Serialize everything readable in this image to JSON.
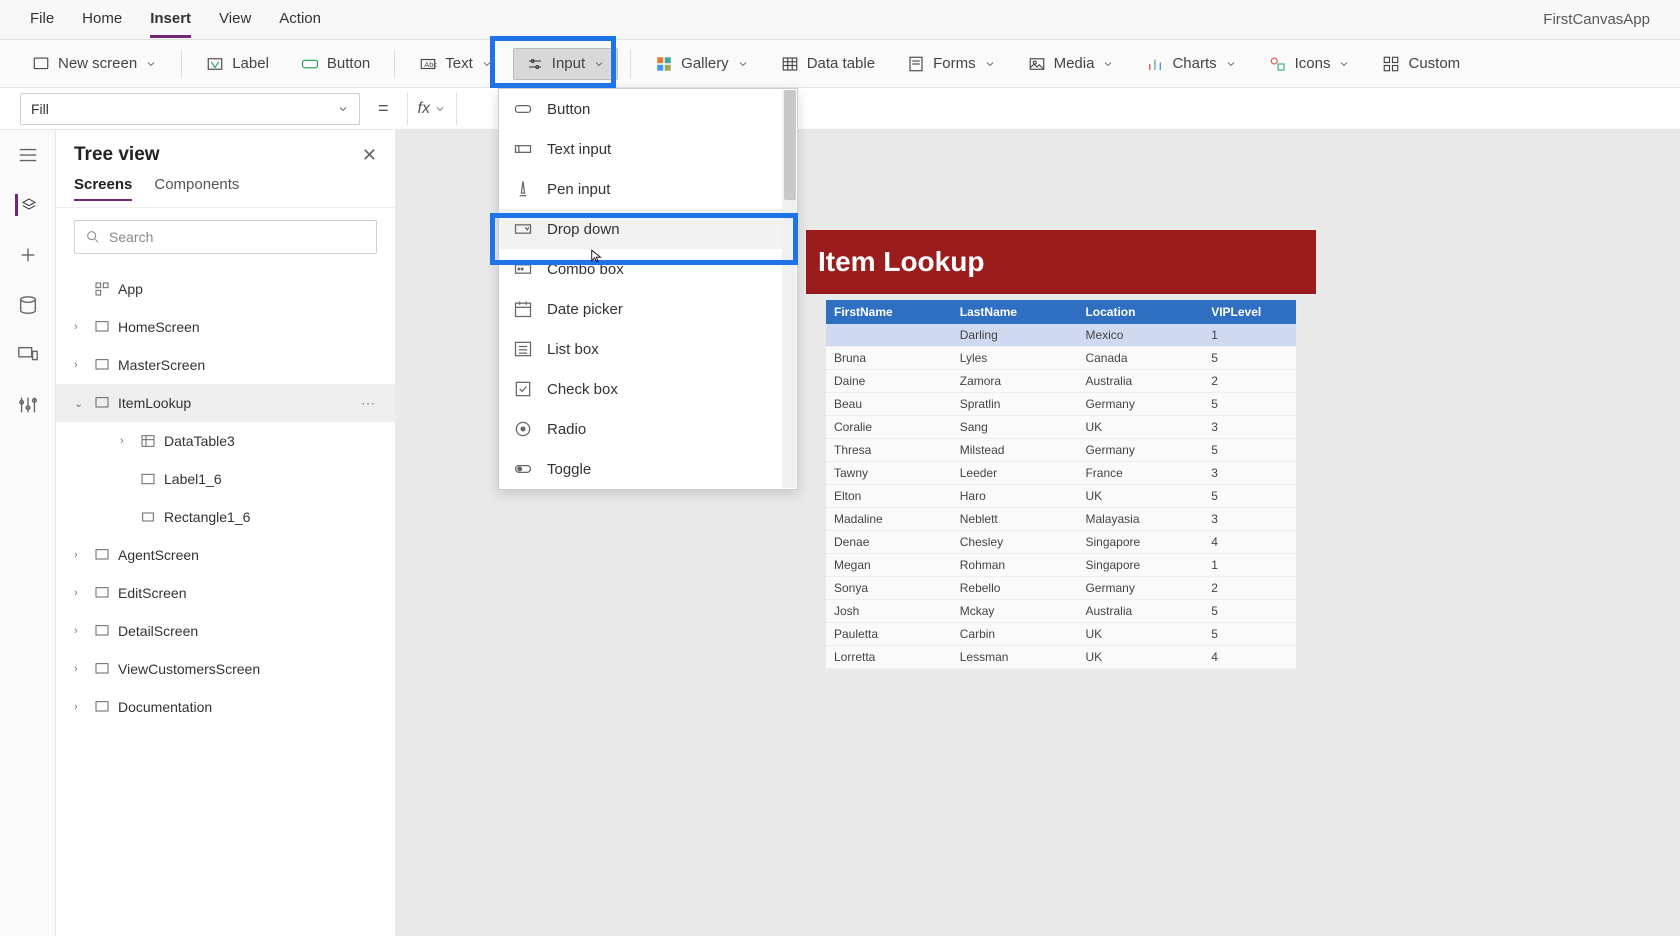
{
  "app_title": "FirstCanvasApp",
  "menubar": [
    "File",
    "Home",
    "Insert",
    "View",
    "Action"
  ],
  "menubar_active": "Insert",
  "ribbon": {
    "new_screen": "New screen",
    "label": "Label",
    "button": "Button",
    "text": "Text",
    "input": "Input",
    "gallery": "Gallery",
    "data_table": "Data table",
    "forms": "Forms",
    "media": "Media",
    "charts": "Charts",
    "icons": "Icons",
    "custom": "Custom"
  },
  "formula": {
    "property": "Fill",
    "fx": "fx"
  },
  "sidebar": {
    "title": "Tree view",
    "tabs": [
      "Screens",
      "Components"
    ],
    "tabs_active": "Screens",
    "search_placeholder": "Search",
    "tree": {
      "app": "App",
      "home": "HomeScreen",
      "master": "MasterScreen",
      "itemlookup": "ItemLookup",
      "datatable3": "DataTable3",
      "label1_6": "Label1_6",
      "rectangle1_6": "Rectangle1_6",
      "agent": "AgentScreen",
      "edit": "EditScreen",
      "detail": "DetailScreen",
      "viewcust": "ViewCustomersScreen",
      "doc": "Documentation"
    }
  },
  "dropdown": {
    "items": [
      "Button",
      "Text input",
      "Pen input",
      "Drop down",
      "Combo box",
      "Date picker",
      "List box",
      "Check box",
      "Radio",
      "Toggle"
    ],
    "highlighted": "Drop down"
  },
  "lookup": {
    "title": "Item Lookup",
    "columns": [
      "FirstName",
      "LastName",
      "Location",
      "VIPLevel"
    ],
    "rows": [
      {
        "first": "",
        "last": "Darling",
        "loc": "Mexico",
        "vip": "1",
        "hl": true
      },
      {
        "first": "Bruna",
        "last": "Lyles",
        "loc": "Canada",
        "vip": "5"
      },
      {
        "first": "Daine",
        "last": "Zamora",
        "loc": "Australia",
        "vip": "2"
      },
      {
        "first": "Beau",
        "last": "Spratlin",
        "loc": "Germany",
        "vip": "5"
      },
      {
        "first": "Coralie",
        "last": "Sang",
        "loc": "UK",
        "vip": "3"
      },
      {
        "first": "Thresa",
        "last": "Milstead",
        "loc": "Germany",
        "vip": "5"
      },
      {
        "first": "Tawny",
        "last": "Leeder",
        "loc": "France",
        "vip": "3"
      },
      {
        "first": "Elton",
        "last": "Haro",
        "loc": "UK",
        "vip": "5"
      },
      {
        "first": "Madaline",
        "last": "Neblett",
        "loc": "Malayasia",
        "vip": "3"
      },
      {
        "first": "Denae",
        "last": "Chesley",
        "loc": "Singapore",
        "vip": "4"
      },
      {
        "first": "Megan",
        "last": "Rohman",
        "loc": "Singapore",
        "vip": "1"
      },
      {
        "first": "Sonya",
        "last": "Rebello",
        "loc": "Germany",
        "vip": "2"
      },
      {
        "first": "Josh",
        "last": "Mckay",
        "loc": "Australia",
        "vip": "5"
      },
      {
        "first": "Pauletta",
        "last": "Carbin",
        "loc": "UK",
        "vip": "5"
      },
      {
        "first": "Lorretta",
        "last": "Lessman",
        "loc": "UK",
        "vip": "4"
      }
    ]
  }
}
